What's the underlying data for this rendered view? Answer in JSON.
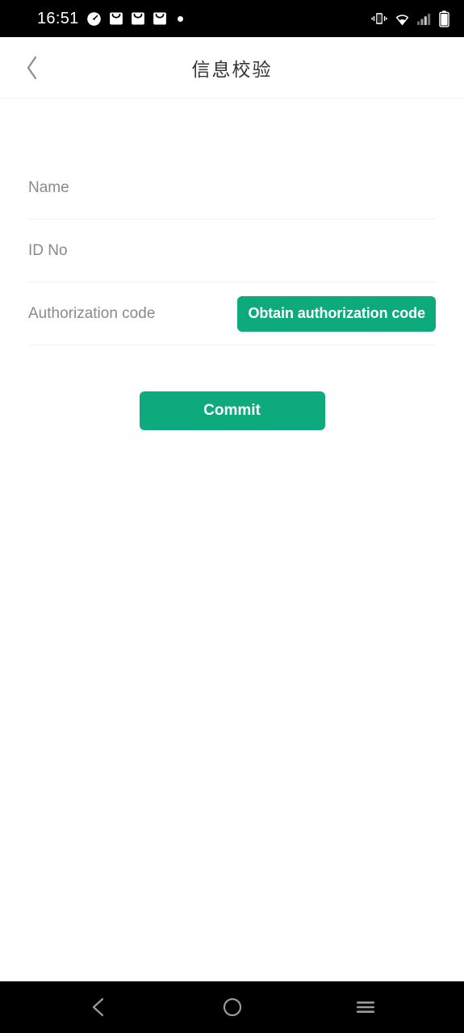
{
  "status_bar": {
    "time": "16:51",
    "left_icons": [
      {
        "name": "speedometer-icon"
      },
      {
        "name": "mail-icon-1"
      },
      {
        "name": "mail-icon-2"
      },
      {
        "name": "mail-icon-3"
      },
      {
        "name": "notification-dot-icon"
      }
    ],
    "right_icons": [
      {
        "name": "vibrate-mode-icon"
      },
      {
        "name": "wifi-icon"
      },
      {
        "name": "cellular-signal-icon"
      },
      {
        "name": "battery-icon"
      }
    ]
  },
  "header": {
    "title": "信息校验",
    "back_icon": "chevron-left-icon"
  },
  "form": {
    "fields": [
      {
        "name": "name",
        "placeholder": "Name",
        "value": ""
      },
      {
        "name": "id_no",
        "placeholder": "ID No",
        "value": ""
      },
      {
        "name": "authorization_code",
        "placeholder": "Authorization code",
        "value": ""
      }
    ],
    "obtain_code_label": "Obtain authorization code",
    "commit_label": "Commit"
  },
  "colors": {
    "accent_green": "#0daa7e",
    "placeholder_gray": "#8a8a8a",
    "title_gray": "#333333",
    "divider": "#f2f2f2",
    "status_bar_bg": "#000000"
  },
  "nav_bar": {
    "back_label": "back-icon",
    "home_label": "home-icon",
    "recents_label": "recents-icon"
  }
}
